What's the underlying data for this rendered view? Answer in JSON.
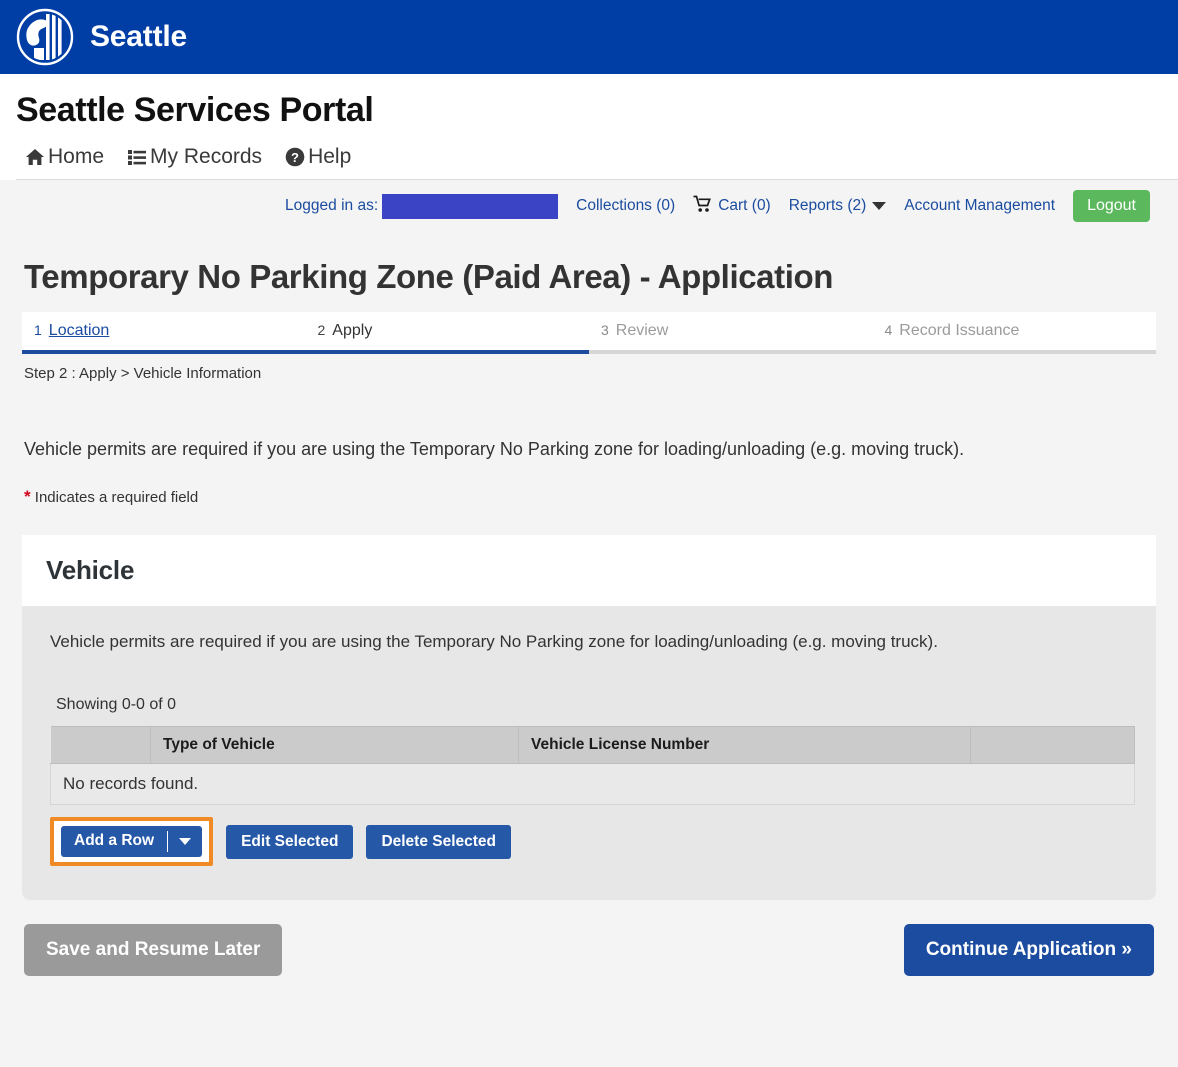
{
  "city_bar": {
    "logo_icon": "seattle-city-seal-icon",
    "name": "Seattle"
  },
  "portal": {
    "title": "Seattle Services Portal",
    "nav": [
      {
        "label": "Home",
        "icon": "home-icon"
      },
      {
        "label": "My Records",
        "icon": "list-icon"
      },
      {
        "label": "Help",
        "icon": "question-circle-icon"
      }
    ]
  },
  "account_bar": {
    "logged_in_label": "Logged in as:",
    "username_redacted": "",
    "collections": "Collections (0)",
    "cart": "Cart (0)",
    "cart_icon": "shopping-cart-icon",
    "reports": "Reports (2)",
    "reports_caret_icon": "caret-down-icon",
    "account_management": "Account Management",
    "logout": "Logout",
    "link_color": "#1b4ca0",
    "logout_color": "#5cb85c"
  },
  "page": {
    "title": "Temporary No Parking Zone (Paid Area) - Application",
    "breadcrumb": "Step 2 : Apply > Vehicle Information",
    "intro": "Vehicle permits are required if you are using the Temporary No Parking zone for loading/unloading (e.g. moving truck).",
    "required_star": "*",
    "required_note": "Indicates a required field"
  },
  "wizard": {
    "progress_percent": 50,
    "accent_color": "#1b4ca0",
    "steps": [
      {
        "num": "1",
        "label": "Location",
        "state": "done"
      },
      {
        "num": "2",
        "label": "Apply",
        "state": "current"
      },
      {
        "num": "3",
        "label": "Review",
        "state": "future"
      },
      {
        "num": "4",
        "label": "Record Issuance",
        "state": "future"
      }
    ]
  },
  "vehicle_section": {
    "heading": "Vehicle",
    "note": "Vehicle permits are required if you are using the Temporary No Parking zone for loading/unloading (e.g. moving truck).",
    "showing": "Showing 0-0 of 0",
    "table": {
      "headers": [
        "",
        "Type of Vehicle",
        "Vehicle License Number",
        ""
      ],
      "empty_message": "No records found.",
      "rows": []
    },
    "actions": {
      "add_row": "Add a Row",
      "add_row_caret_icon": "caret-down-icon",
      "add_row_focus_color": "#f08a24",
      "edit_selected": "Edit Selected",
      "delete_selected": "Delete Selected",
      "button_color": "#2658a8"
    }
  },
  "footer": {
    "save_resume": "Save and Resume Later",
    "continue": "Continue Application »",
    "save_color": "#9a9a9a",
    "continue_color": "#1b4ca0"
  }
}
